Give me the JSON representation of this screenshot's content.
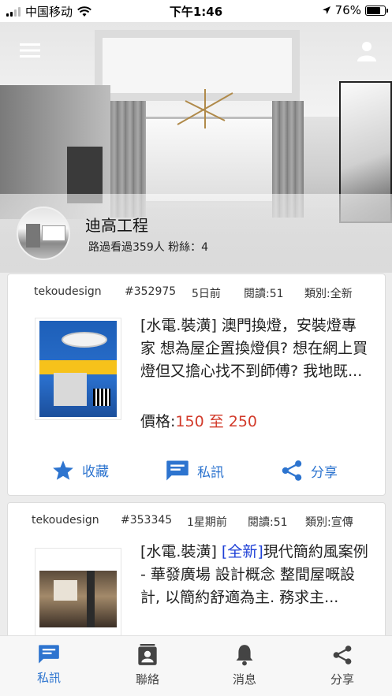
{
  "status_bar": {
    "carrier": "中国移动",
    "time": "下午1:46",
    "battery": "76%",
    "battery_level": 0.76
  },
  "header": {
    "menu_icon": "hamburger-menu-icon",
    "user_icon": "user-icon"
  },
  "profile": {
    "name": "迪高工程",
    "stats": "路過看過359人  粉絲：4"
  },
  "posts": [
    {
      "author": "tekoudesign",
      "id": "#352975",
      "time": "5日前",
      "reads": "閱讀:51",
      "category": "類別:全新",
      "title_prefix": "[水電.裝潢] ",
      "title_highlight": "",
      "title_text": "澳門換燈，安裝燈專家 想為屋企置換燈俱? 想在網上買燈但又擔心找不到師傅? 我地既...",
      "price_label": "價格:",
      "price_value": "150 至 250"
    },
    {
      "author": "tekoudesign",
      "id": "#353345",
      "time": "1星期前",
      "reads": "閱讀:51",
      "category": "類別:宣傳",
      "title_prefix": "[水電.裝潢] ",
      "title_bracket_open": "[",
      "title_highlight": "全新",
      "title_bracket_close": "]",
      "title_text": "現代簡約風案例 - 華發廣場 設計概念 整間屋嘅設計, 以簡約舒適為主. 務求主..."
    }
  ],
  "actions": {
    "favorite": "收藏",
    "message": "私訊",
    "share": "分享"
  },
  "bottom_nav": [
    {
      "label": "私訊",
      "icon": "message-icon",
      "active": true
    },
    {
      "label": "聯絡",
      "icon": "contact-icon",
      "active": false
    },
    {
      "label": "消息",
      "icon": "bell-icon",
      "active": false
    },
    {
      "label": "分享",
      "icon": "share-icon",
      "active": false
    }
  ],
  "colors": {
    "accent": "#2d74cf",
    "price": "#d23a2a",
    "highlight": "#1d3fd6"
  }
}
